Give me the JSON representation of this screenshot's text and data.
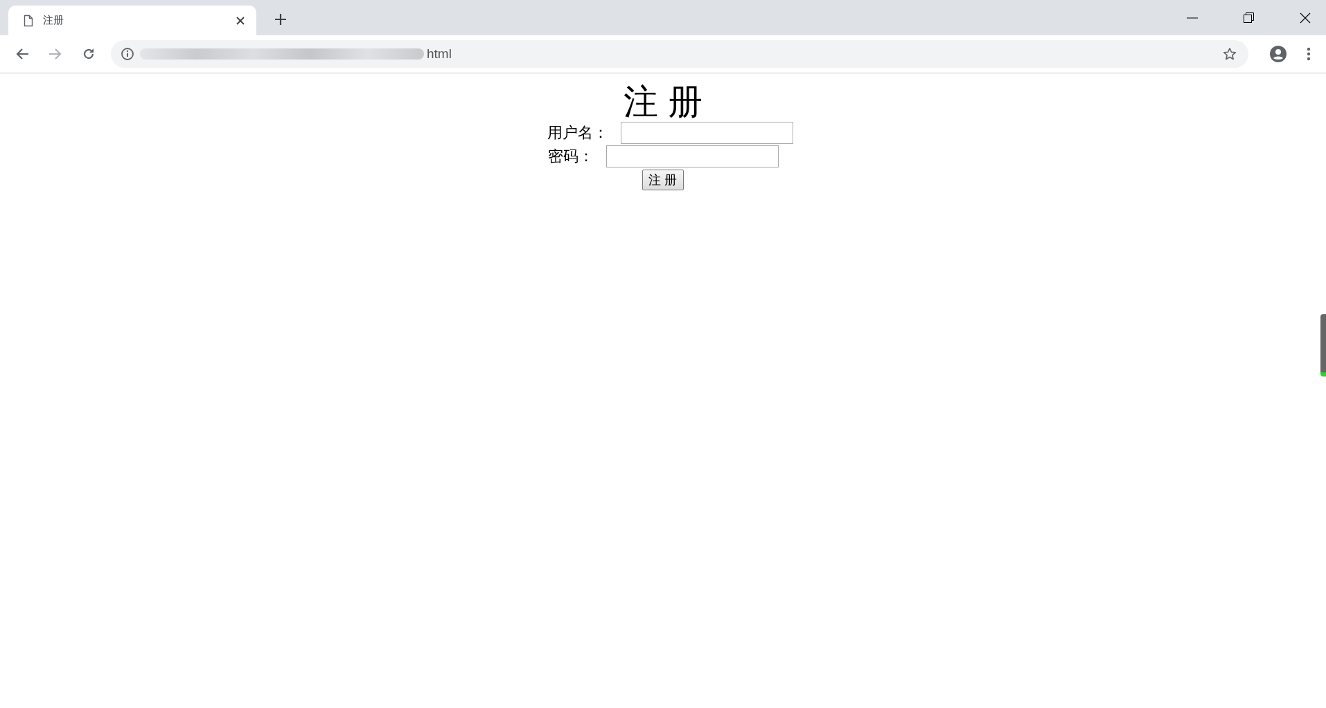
{
  "browser": {
    "tab_title": "注册",
    "address": "html"
  },
  "page": {
    "heading": "注 册",
    "fields": [
      {
        "label": "用户名：",
        "kind": "text"
      },
      {
        "label": "密码：",
        "kind": "password"
      }
    ],
    "submit": "注 册"
  }
}
